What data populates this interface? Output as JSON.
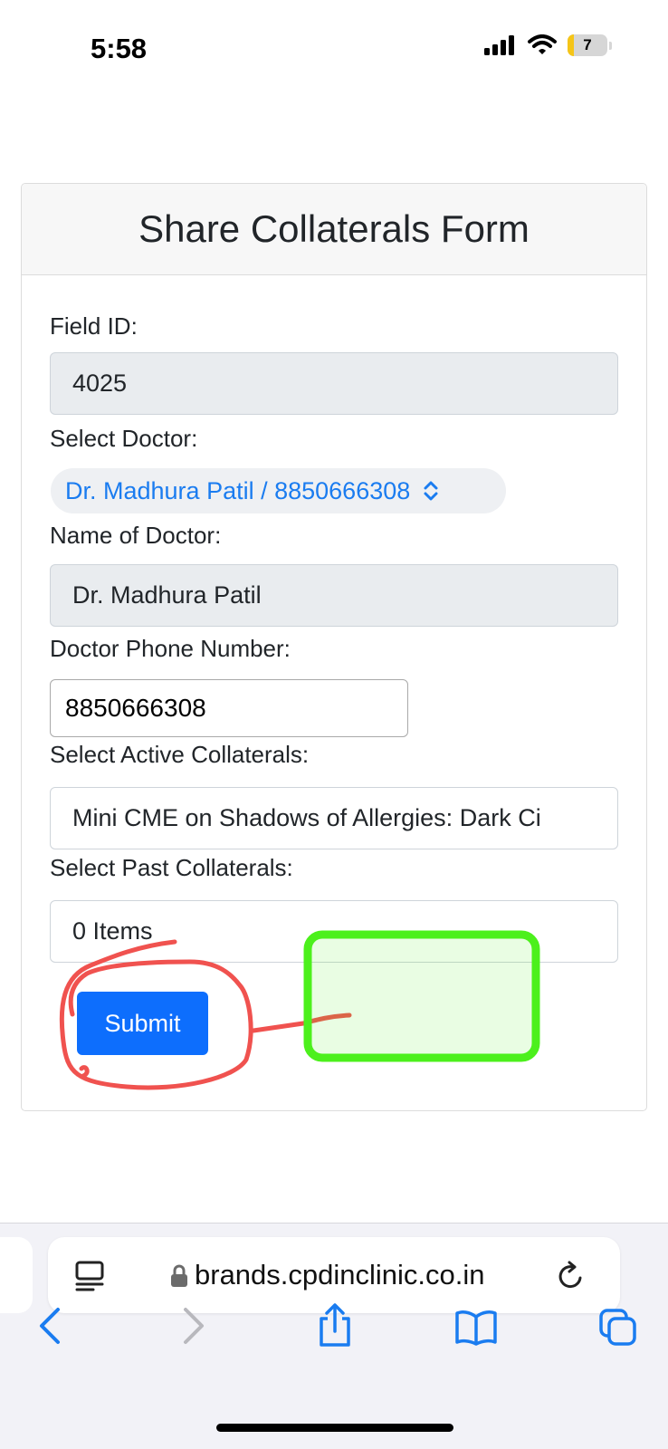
{
  "status_bar": {
    "time": "5:58",
    "battery_level": "7",
    "signal_icon": "cellular-signal-icon",
    "wifi_icon": "wifi-icon"
  },
  "form": {
    "title": "Share Collaterals Form",
    "field_id_label": "Field ID:",
    "field_id_value": "4025",
    "select_doctor_label": "Select Doctor:",
    "select_doctor_value": "Dr. Madhura Patil / 8850666308",
    "doctor_name_label": "Name of Doctor:",
    "doctor_name_value": "Dr. Madhura Patil",
    "doctor_phone_label": "Doctor Phone Number:",
    "doctor_phone_value": "8850666308",
    "active_collaterals_label": "Select Active Collaterals:",
    "active_collaterals_value": "Mini CME on Shadows of Allergies: Dark Ci",
    "past_collaterals_label": "Select Past Collaterals:",
    "past_collaterals_value": "0 Items",
    "submit_label": "Submit"
  },
  "annotations": {
    "circle_color": "#f0524f",
    "box_color": "#4cf01c"
  },
  "browser": {
    "url": "brands.cpdinclinic.co.in",
    "icons": [
      "reader-icon",
      "lock-icon",
      "reload-icon",
      "back-icon",
      "forward-icon",
      "share-icon",
      "bookmarks-icon",
      "tabs-icon"
    ]
  },
  "colors": {
    "accent": "#0d6efd",
    "link_blue": "#1a7cf0",
    "readonly_bg": "#e9ecef"
  }
}
